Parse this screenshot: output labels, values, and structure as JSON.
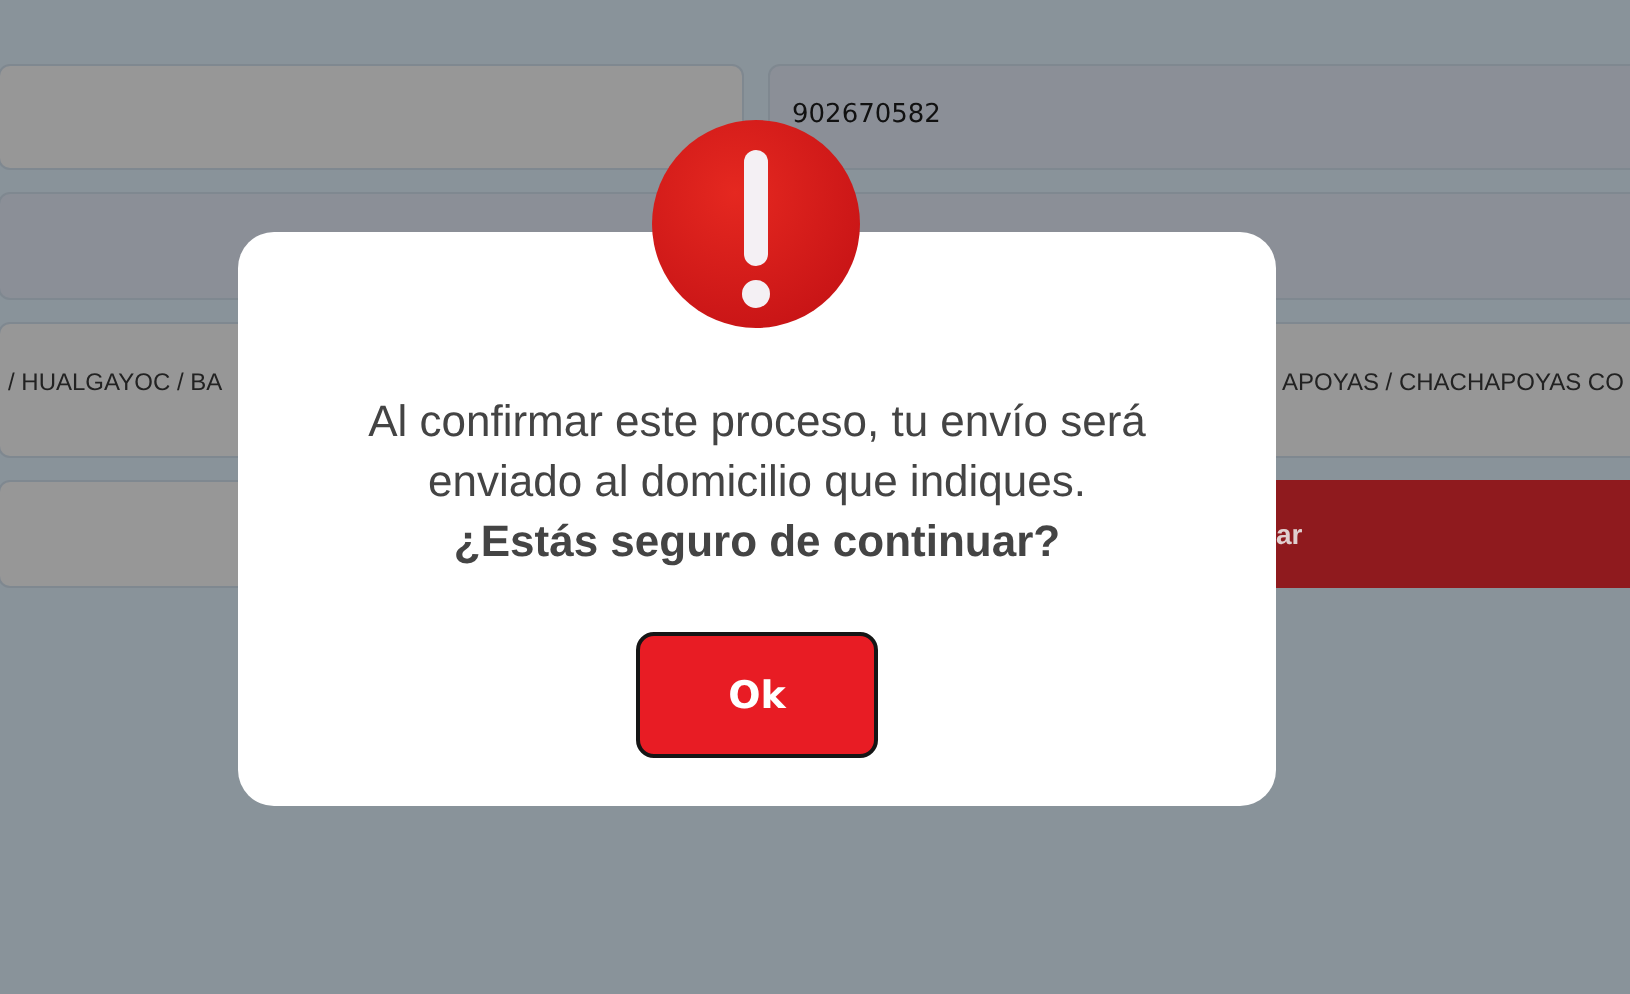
{
  "form": {
    "fields": [
      {
        "kind": "field",
        "disabled": true
      },
      {
        "kind": "field",
        "disabled": false,
        "value": "902670582"
      },
      {
        "kind": "field",
        "disabled": false
      },
      {
        "kind": "field",
        "disabled": false
      },
      {
        "kind": "field",
        "disabled": true,
        "value": "/ HUALGAYOC / BA"
      },
      {
        "kind": "field",
        "disabled": true,
        "value": "APOYAS / CHACHAPOYAS CO"
      },
      {
        "kind": "field",
        "disabled": true
      },
      {
        "kind": "button",
        "label": "ar"
      }
    ]
  },
  "dialog": {
    "message": "Al confirmar este proceso, tu envío será enviado al domicilio que indiques. **¿Estás seguro de continuar?**",
    "button": "Ok"
  }
}
